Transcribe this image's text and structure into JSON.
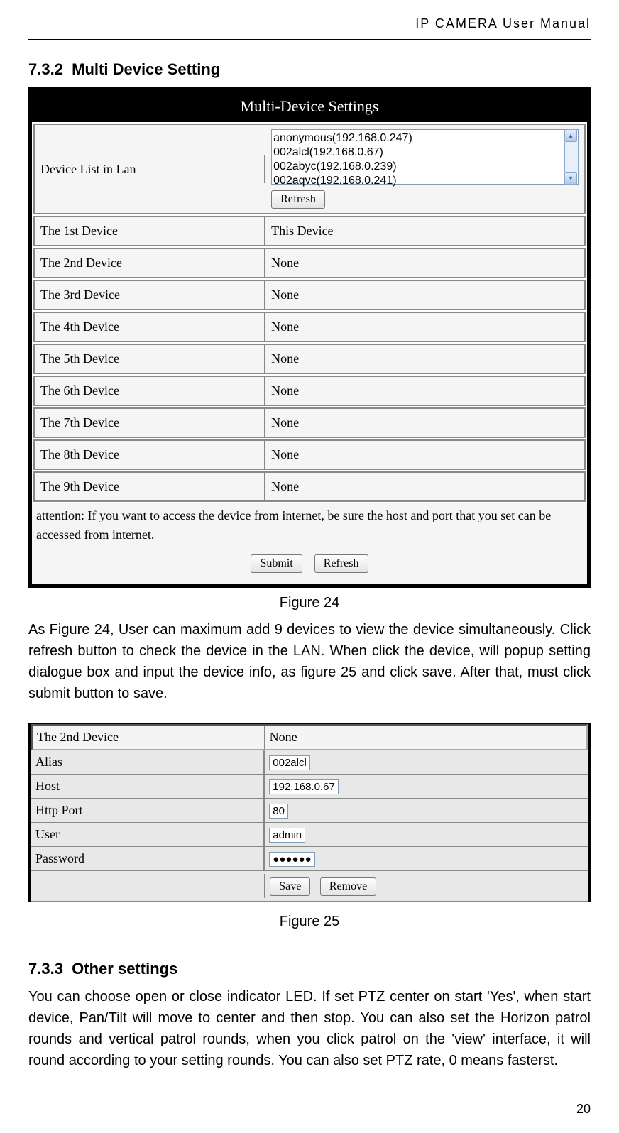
{
  "header": "IP CAMERA User Manual",
  "section1": {
    "number": "7.3.2",
    "title": "Multi Device Setting"
  },
  "figure24": {
    "titlebar": "Multi-Device Settings",
    "deviceListLabel": "Device List in Lan",
    "deviceListItems": [
      "anonymous(192.168.0.247)",
      "002alcl(192.168.0.67)",
      "002abyc(192.168.0.239)",
      "002aqvc(192.168.0.241)"
    ],
    "refreshBtn": "Refresh",
    "rows": [
      {
        "label": "The 1st Device",
        "value": "This Device"
      },
      {
        "label": "The 2nd Device",
        "value": "None"
      },
      {
        "label": "The 3rd Device",
        "value": "None"
      },
      {
        "label": "The 4th Device",
        "value": "None"
      },
      {
        "label": "The 5th Device",
        "value": "None"
      },
      {
        "label": "The 6th Device",
        "value": "None"
      },
      {
        "label": "The 7th Device",
        "value": "None"
      },
      {
        "label": "The 8th Device",
        "value": "None"
      },
      {
        "label": "The 9th Device",
        "value": "None"
      }
    ],
    "attention": "attention: If you want to access the device from internet, be sure the host and port that you set can be accessed from internet.",
    "submitBtn": "Submit",
    "refreshBtn2": "Refresh",
    "caption": "Figure 24"
  },
  "paragraph1": "As Figure 24, User can maximum add 9 devices to view the device simultaneously. Click refresh button to check the device in the LAN. When click the device, will popup setting dialogue box and input the device info, as figure 25 and click save. After that, must click submit button to save.",
  "figure25": {
    "headerLabel": "The 2nd Device",
    "headerValue": "None",
    "fields": {
      "alias": {
        "label": "Alias",
        "value": "002alcl"
      },
      "host": {
        "label": "Host",
        "value": "192.168.0.67"
      },
      "httpport": {
        "label": "Http Port",
        "value": "80"
      },
      "user": {
        "label": "User",
        "value": "admin"
      },
      "password": {
        "label": "Password",
        "value": "●●●●●●"
      }
    },
    "saveBtn": "Save",
    "removeBtn": "Remove",
    "caption": "Figure 25"
  },
  "section2": {
    "number": "7.3.3",
    "title": "Other settings"
  },
  "paragraph2": "You can choose open or close indicator LED. If set PTZ center on start 'Yes', when start device, Pan/Tilt will move to center and then stop. You can also set the Horizon patrol rounds and vertical patrol rounds, when you click patrol on the 'view' interface, it will round according to your setting rounds. You can also set PTZ rate, 0 means fasterst.",
  "pageNum": "20"
}
